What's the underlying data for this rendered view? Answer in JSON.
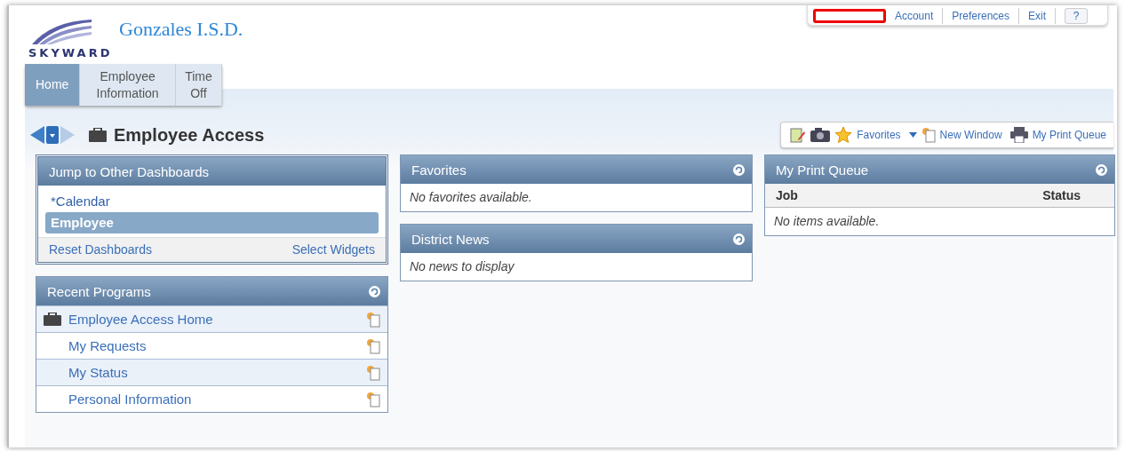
{
  "header": {
    "district": "Gonzales I.S.D.",
    "logo_text": "SKYWARD",
    "links": [
      "Account",
      "Preferences",
      "Exit"
    ],
    "help": "?"
  },
  "tabs": [
    {
      "label": "Home",
      "selected": true
    },
    {
      "label": "Employee Information",
      "selected": false
    },
    {
      "label": "Time Off",
      "selected": false
    }
  ],
  "page_title": "Employee Access",
  "toolbar": {
    "favorites": "Favorites",
    "new_window": "New Window",
    "print_queue": "My Print Queue"
  },
  "dashboards": {
    "title": "Jump to Other Dashboards",
    "items": [
      {
        "label": "*Calendar",
        "selected": false
      },
      {
        "label": "Employee",
        "selected": true
      }
    ],
    "reset": "Reset Dashboards",
    "select": "Select Widgets"
  },
  "recent_programs": {
    "title": "Recent Programs",
    "items": [
      {
        "label": "Employee Access Home",
        "kind": "home"
      },
      {
        "label": "My Requests",
        "kind": "link"
      },
      {
        "label": "My Status",
        "kind": "link"
      },
      {
        "label": "Personal Information",
        "kind": "link"
      }
    ]
  },
  "favorites": {
    "title": "Favorites",
    "empty": "No favorites available."
  },
  "district_news": {
    "title": "District News",
    "empty": "No news to display"
  },
  "print_queue": {
    "title": "My Print Queue",
    "columns": [
      "Job",
      "Status"
    ],
    "empty": "No items available."
  }
}
